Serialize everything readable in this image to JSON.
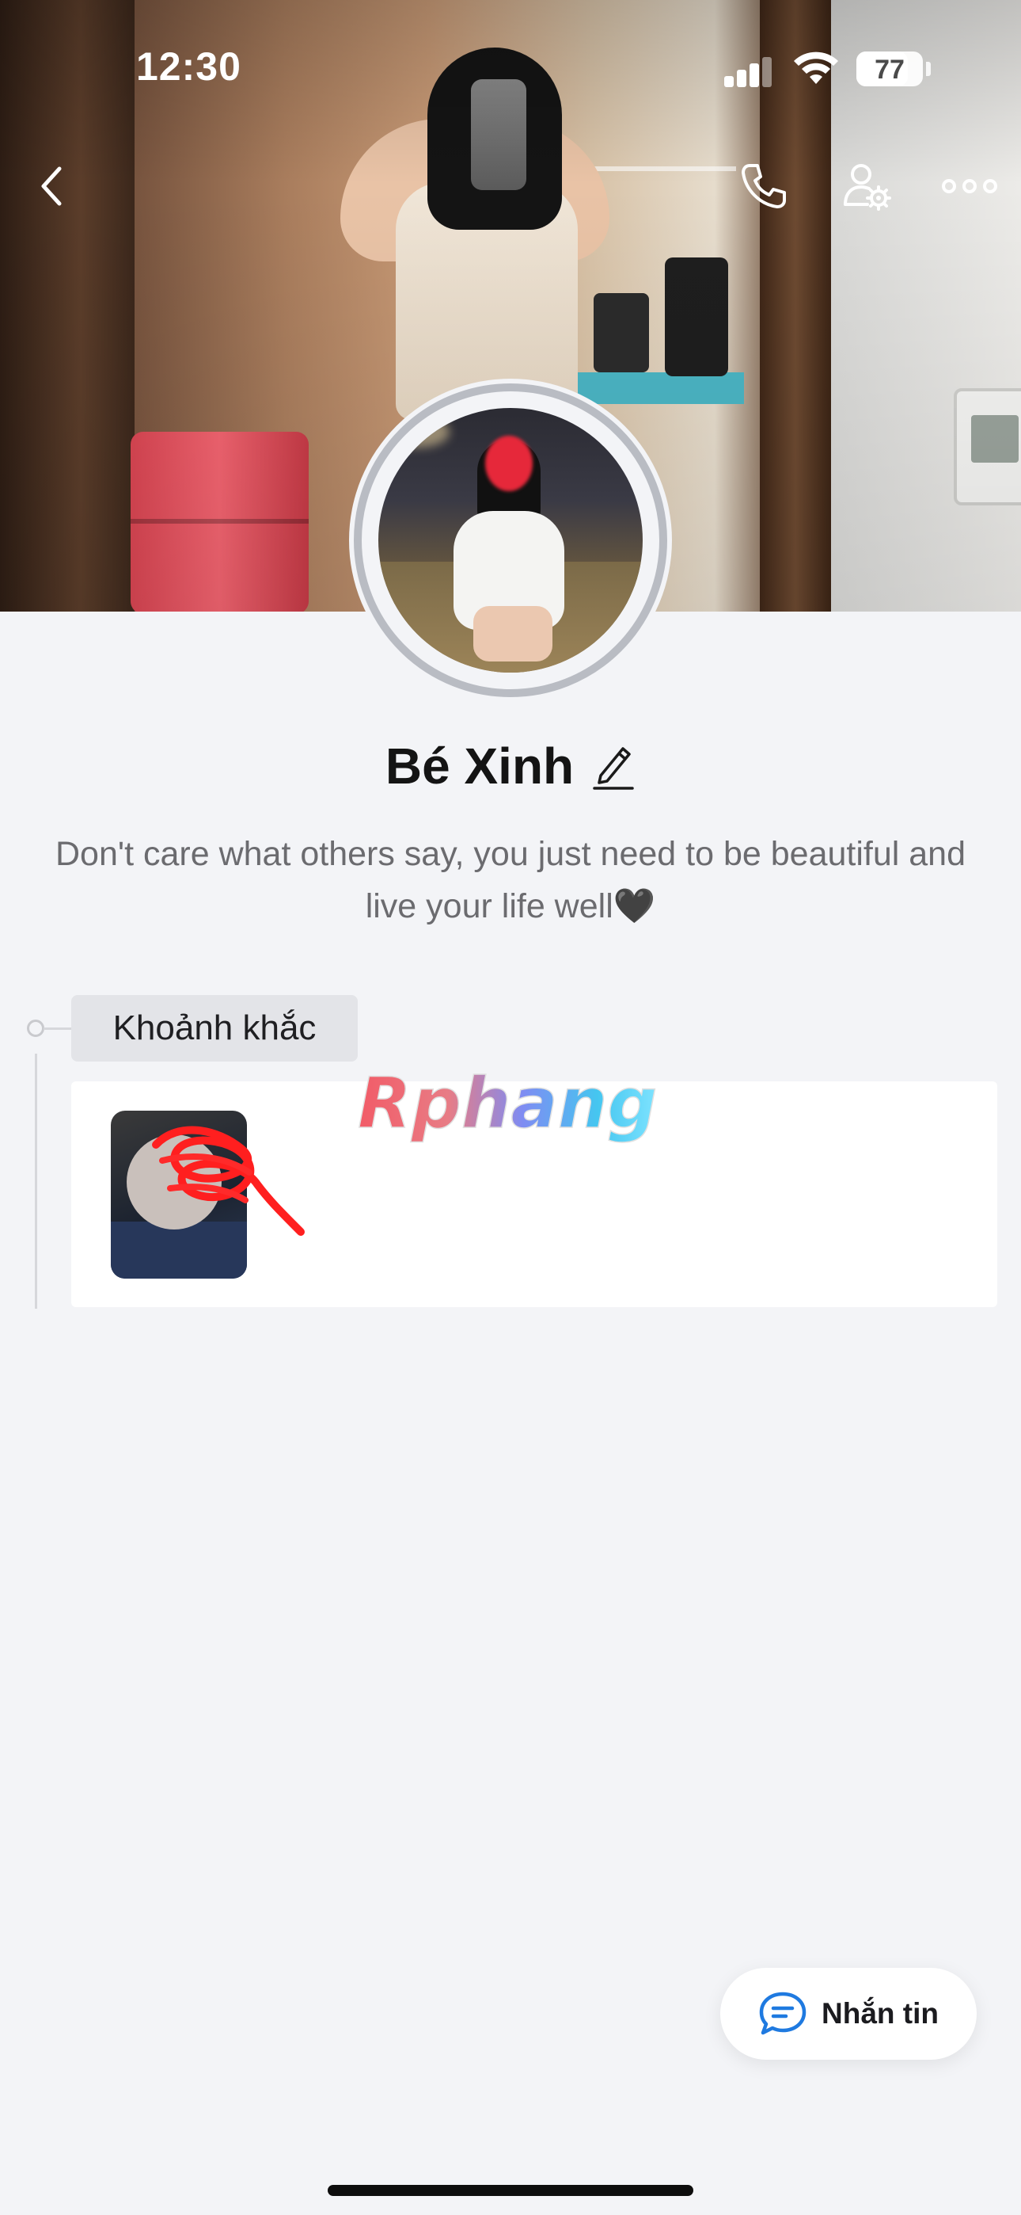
{
  "status_bar": {
    "time": "12:30",
    "battery_level": "77",
    "icons": [
      "signal-icon",
      "wifi-icon",
      "battery-icon"
    ]
  },
  "nav": {
    "back_icon": "chevron-left-icon",
    "call_icon": "phone-icon",
    "settings_icon": "user-settings-icon",
    "more_icon": "more-horizontal-icon"
  },
  "profile": {
    "name": "Bé Xinh",
    "edit_icon": "pencil-icon",
    "bio": "Don't care what others say, you just need to be beautiful and live your life well🖤"
  },
  "moments": {
    "label": "Khoảnh khắc"
  },
  "watermark": "Rphang",
  "actions": {
    "message_label": "Nhắn tin",
    "message_icon": "chat-bubble-icon"
  },
  "colors": {
    "accent": "#1f7ae0",
    "background": "#f3f4f7",
    "card": "#ffffff",
    "label_bg": "#e3e4e8"
  }
}
